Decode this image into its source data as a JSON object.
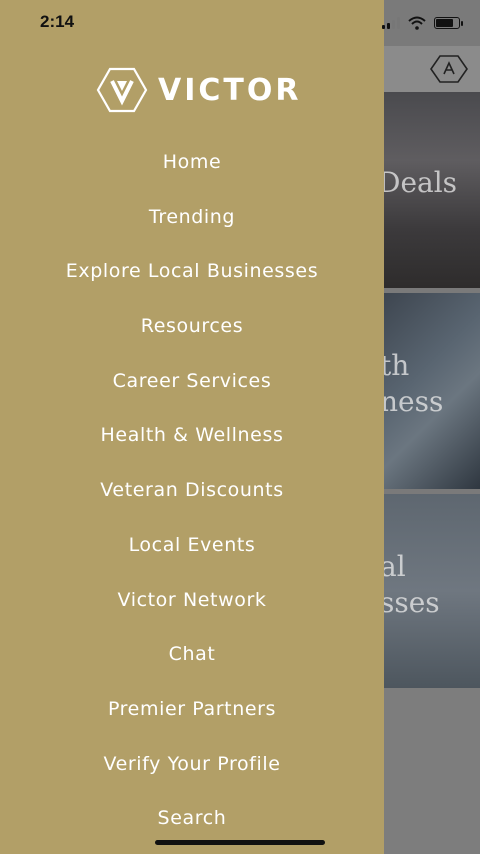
{
  "status_bar": {
    "time": "2:14",
    "signal_icon": "cellular-signal-icon",
    "wifi_icon": "wifi-icon",
    "battery_icon": "battery-icon"
  },
  "drawer": {
    "brand": {
      "logo_icon": "victor-shield-logo-icon",
      "name": "VICTOR"
    },
    "menu_items": [
      {
        "label": "Home"
      },
      {
        "label": "Trending"
      },
      {
        "label": "Explore Local Businesses"
      },
      {
        "label": "Resources"
      },
      {
        "label": "Career Services"
      },
      {
        "label": "Health & Wellness"
      },
      {
        "label": "Veteran Discounts"
      },
      {
        "label": "Local Events"
      },
      {
        "label": "Victor Network"
      },
      {
        "label": "Chat"
      },
      {
        "label": "Premier Partners"
      },
      {
        "label": "Verify Your Profile"
      },
      {
        "label": "Search"
      }
    ],
    "background_color": "#b29f67"
  },
  "background_app": {
    "header_logo_icon": "victor-header-logo-icon",
    "cards": [
      {
        "text_line1": "Deals",
        "text_line2": ""
      },
      {
        "text_line1": "th",
        "text_line2": "ness"
      },
      {
        "text_line1": "al",
        "text_line2": "sses"
      }
    ]
  }
}
